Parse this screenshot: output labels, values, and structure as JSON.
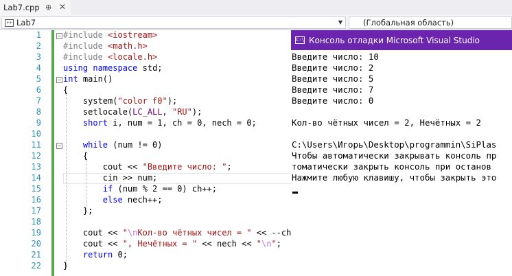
{
  "tab": {
    "title": "Lab7.cpp",
    "pin": "⊕",
    "close": "✕"
  },
  "nav": {
    "project": "Lab7",
    "scope": "(Глобальная область)"
  },
  "console": {
    "title": "Консоль отладки Microsoft Visual Studio",
    "lines": [
      "Введите число: 10",
      "Введите число: 2",
      "Введите число: 5",
      "Введите число: 7",
      "Введите число: 0",
      "",
      "Кол-во чётных чисел = 2, Нечётных = 2",
      "",
      "C:\\Users\\Игорь\\Desktop\\programmin\\SiPlas",
      "Чтобы автоматически закрывать консоль пр",
      "томатически закрыть консоль при останов",
      "Нажмите любую клавишу, чтобы закрыть это"
    ]
  },
  "editor": {
    "line_numbers": [
      "1",
      "2",
      "3",
      "4",
      "5",
      "6",
      "7",
      "8",
      "9",
      "10",
      "11",
      "12",
      "13",
      "14",
      "15",
      "16",
      "17",
      "18",
      "19",
      "20",
      "21",
      "22"
    ],
    "code_lines": [
      "#include <iostream>",
      "#include <math.h>",
      "#include <locale.h>",
      "using namespace std;",
      "int main()",
      "{",
      "    system(\"color f0\");",
      "    setlocale(LC_ALL, \"RU\");",
      "    short i, num = 1, ch = 0, nech = 0;",
      "",
      "    while (num != 0)",
      "    {",
      "        cout << \"Введите число: \";",
      "        cin >> num;",
      "        if (num % 2 == 0) ch++;",
      "        else nech++;",
      "    };",
      "",
      "    cout << \"\\nКол-во чётных чисел = \" << --ch;",
      "    cout << \", Нечётных = \" << nech << \"\\n\";",
      "    return 0;",
      "}"
    ]
  }
}
